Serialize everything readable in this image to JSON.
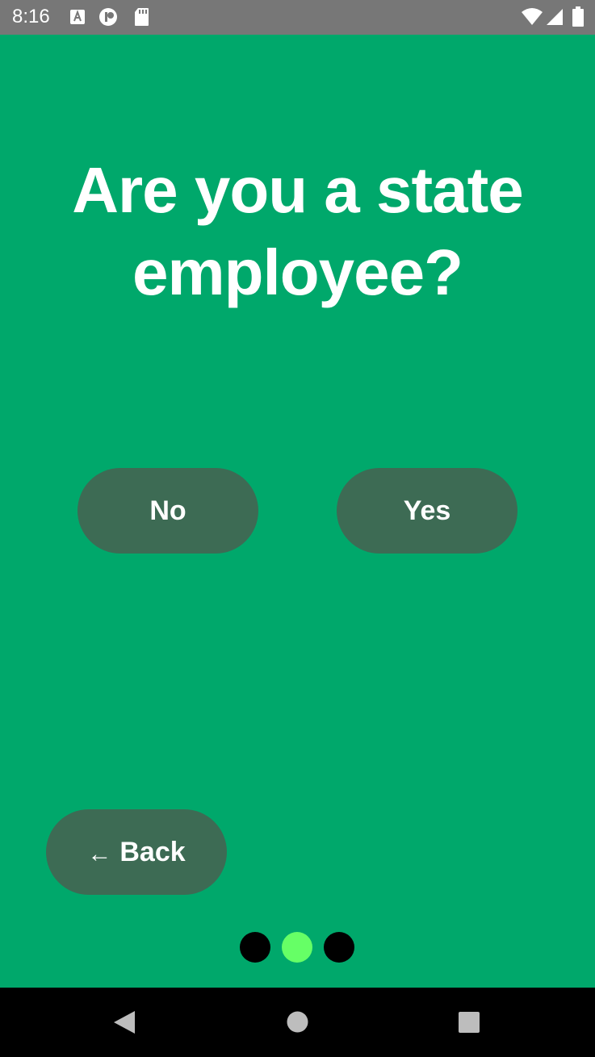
{
  "status_bar": {
    "time": "8:16",
    "icons": [
      "a-box-icon",
      "p-circle-icon",
      "sd-card-icon",
      "wifi-icon",
      "signal-icon",
      "battery-icon"
    ]
  },
  "screen": {
    "background_color": "#00a86b",
    "question": "Are you a state employee?",
    "answers": {
      "no_label": "No",
      "yes_label": "Yes"
    },
    "back": {
      "arrow": "←",
      "label": "Back"
    },
    "button_color": "#3d6b54",
    "progress": {
      "total_steps": 3,
      "current_step": 2,
      "active_color": "#66ff66",
      "inactive_color": "#000000"
    }
  },
  "nav_bar": {
    "buttons": [
      "back-triangle-icon",
      "home-circle-icon",
      "recent-square-icon"
    ]
  }
}
